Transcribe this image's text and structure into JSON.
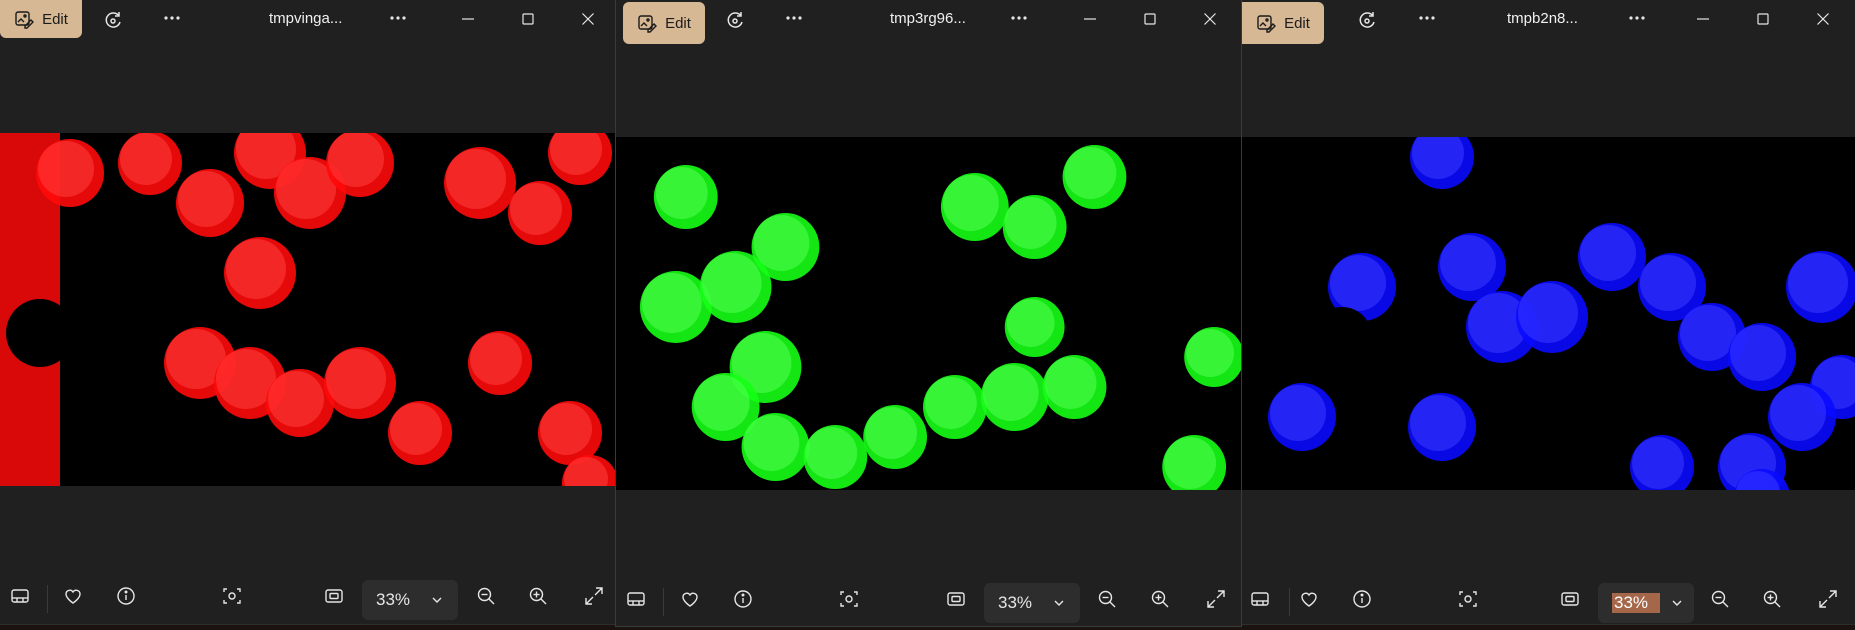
{
  "colors": {
    "accent": "#d6b894",
    "window_bg": "#202020",
    "red_channel": "#ff0000",
    "green_channel": "#00ff00",
    "blue_channel": "#0000ff"
  },
  "windows": [
    {
      "title": "tmpvinga...",
      "edit_label": "Edit",
      "zoom": "33%",
      "channel": "red"
    },
    {
      "title": "tmp3rg96...",
      "edit_label": "Edit",
      "zoom": "33%",
      "channel": "green"
    },
    {
      "title": "tmpb2n8...",
      "edit_label": "Edit",
      "zoom": "33%",
      "channel": "blue"
    }
  ],
  "icons": {
    "edit": "edit-image-icon",
    "rotate": "rotate-icon",
    "more": "more-icon",
    "minimize": "minimize-icon",
    "maximize": "maximize-icon",
    "close": "close-icon",
    "filmstrip": "filmstrip-icon",
    "favorite": "heart-icon",
    "info": "info-icon",
    "visual_search": "visual-search-icon",
    "actual_size": "actual-size-icon",
    "zoom_out": "zoom-out-icon",
    "zoom_in": "zoom-in-icon",
    "fullscreen": "expand-icon"
  }
}
